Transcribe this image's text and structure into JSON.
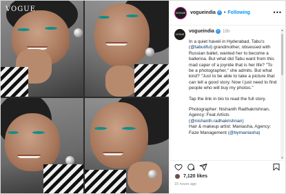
{
  "media": {
    "brand": "VOGUE"
  },
  "header": {
    "username": "vogueindia",
    "follow_label": "Following",
    "avatar_text": "VOGUE"
  },
  "caption": {
    "username": "vogueindia",
    "time": "15h",
    "p1_a": "In a quiet haveli in Hyderabad, Tabu's ",
    "p1_mention": "(@tabutiful)",
    "p1_b": " grandmother, obsessed with Russian ballet, wanted her to become a ballerina. But what did Tabu want from this mad caper of a joyride that is her life? \"To be a photographer,\" she admits. But what kind? \"Just to be able to take a picture that can tell a good story. Now I just need to find people who will buy my photos.\"",
    "p2": "Tap the link in bio to read the full story.",
    "p3_a": "Photographer: Nishanth Radhakrishnan, Agency: Feat Artists ",
    "p3_mention": "(@nishanth.radhakrishnan)",
    "p3_b": "Hair & makeup artist: Maniasha, Agency: Faze Management ",
    "p3_mention2": "(@bymaniasha)"
  },
  "footer": {
    "likes": "7,120 likes",
    "ago": "15 hours ago"
  },
  "colors": {
    "accent": "#0095f6",
    "verified": "#3897f0",
    "mention": "#00376b"
  },
  "icons": [
    "more-icon",
    "verified-icon",
    "heart-icon",
    "comment-icon",
    "share-icon",
    "bookmark-icon"
  ]
}
